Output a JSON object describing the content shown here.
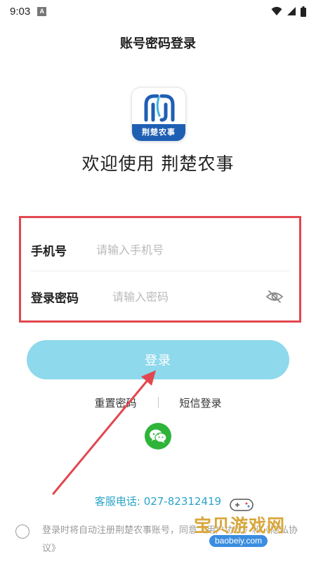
{
  "status_bar": {
    "time": "9:03",
    "notification_badge": "A"
  },
  "header": {
    "title": "账号密码登录"
  },
  "logo": {
    "band_text": "荆楚农事",
    "brand_color": "#1f5fb3"
  },
  "welcome": {
    "text": "欢迎使用 荆楚农事"
  },
  "form": {
    "phone_label": "手机号",
    "phone_placeholder": "请输入手机号",
    "phone_value": "",
    "password_label": "登录密码",
    "password_placeholder": "请输入密码",
    "password_value": "",
    "highlight_color": "#e2474f"
  },
  "login_button": {
    "label": "登录",
    "color": "#8ed9ec"
  },
  "links": {
    "reset_password": "重置密码",
    "sms_login": "短信登录"
  },
  "wechat": {
    "icon": "wechat-icon",
    "color": "#2fb43a"
  },
  "hotline": {
    "text": "客服电话: 027-82312419"
  },
  "agreement": {
    "text": "登录时将自动注册荆楚农事账号，同意《用户协议》和《隐私协议》",
    "checked": false
  },
  "watermark": {
    "title": "宝贝游戏网",
    "url": "baobeiy.com"
  },
  "annotation": {
    "arrow_color": "#e2474f"
  }
}
